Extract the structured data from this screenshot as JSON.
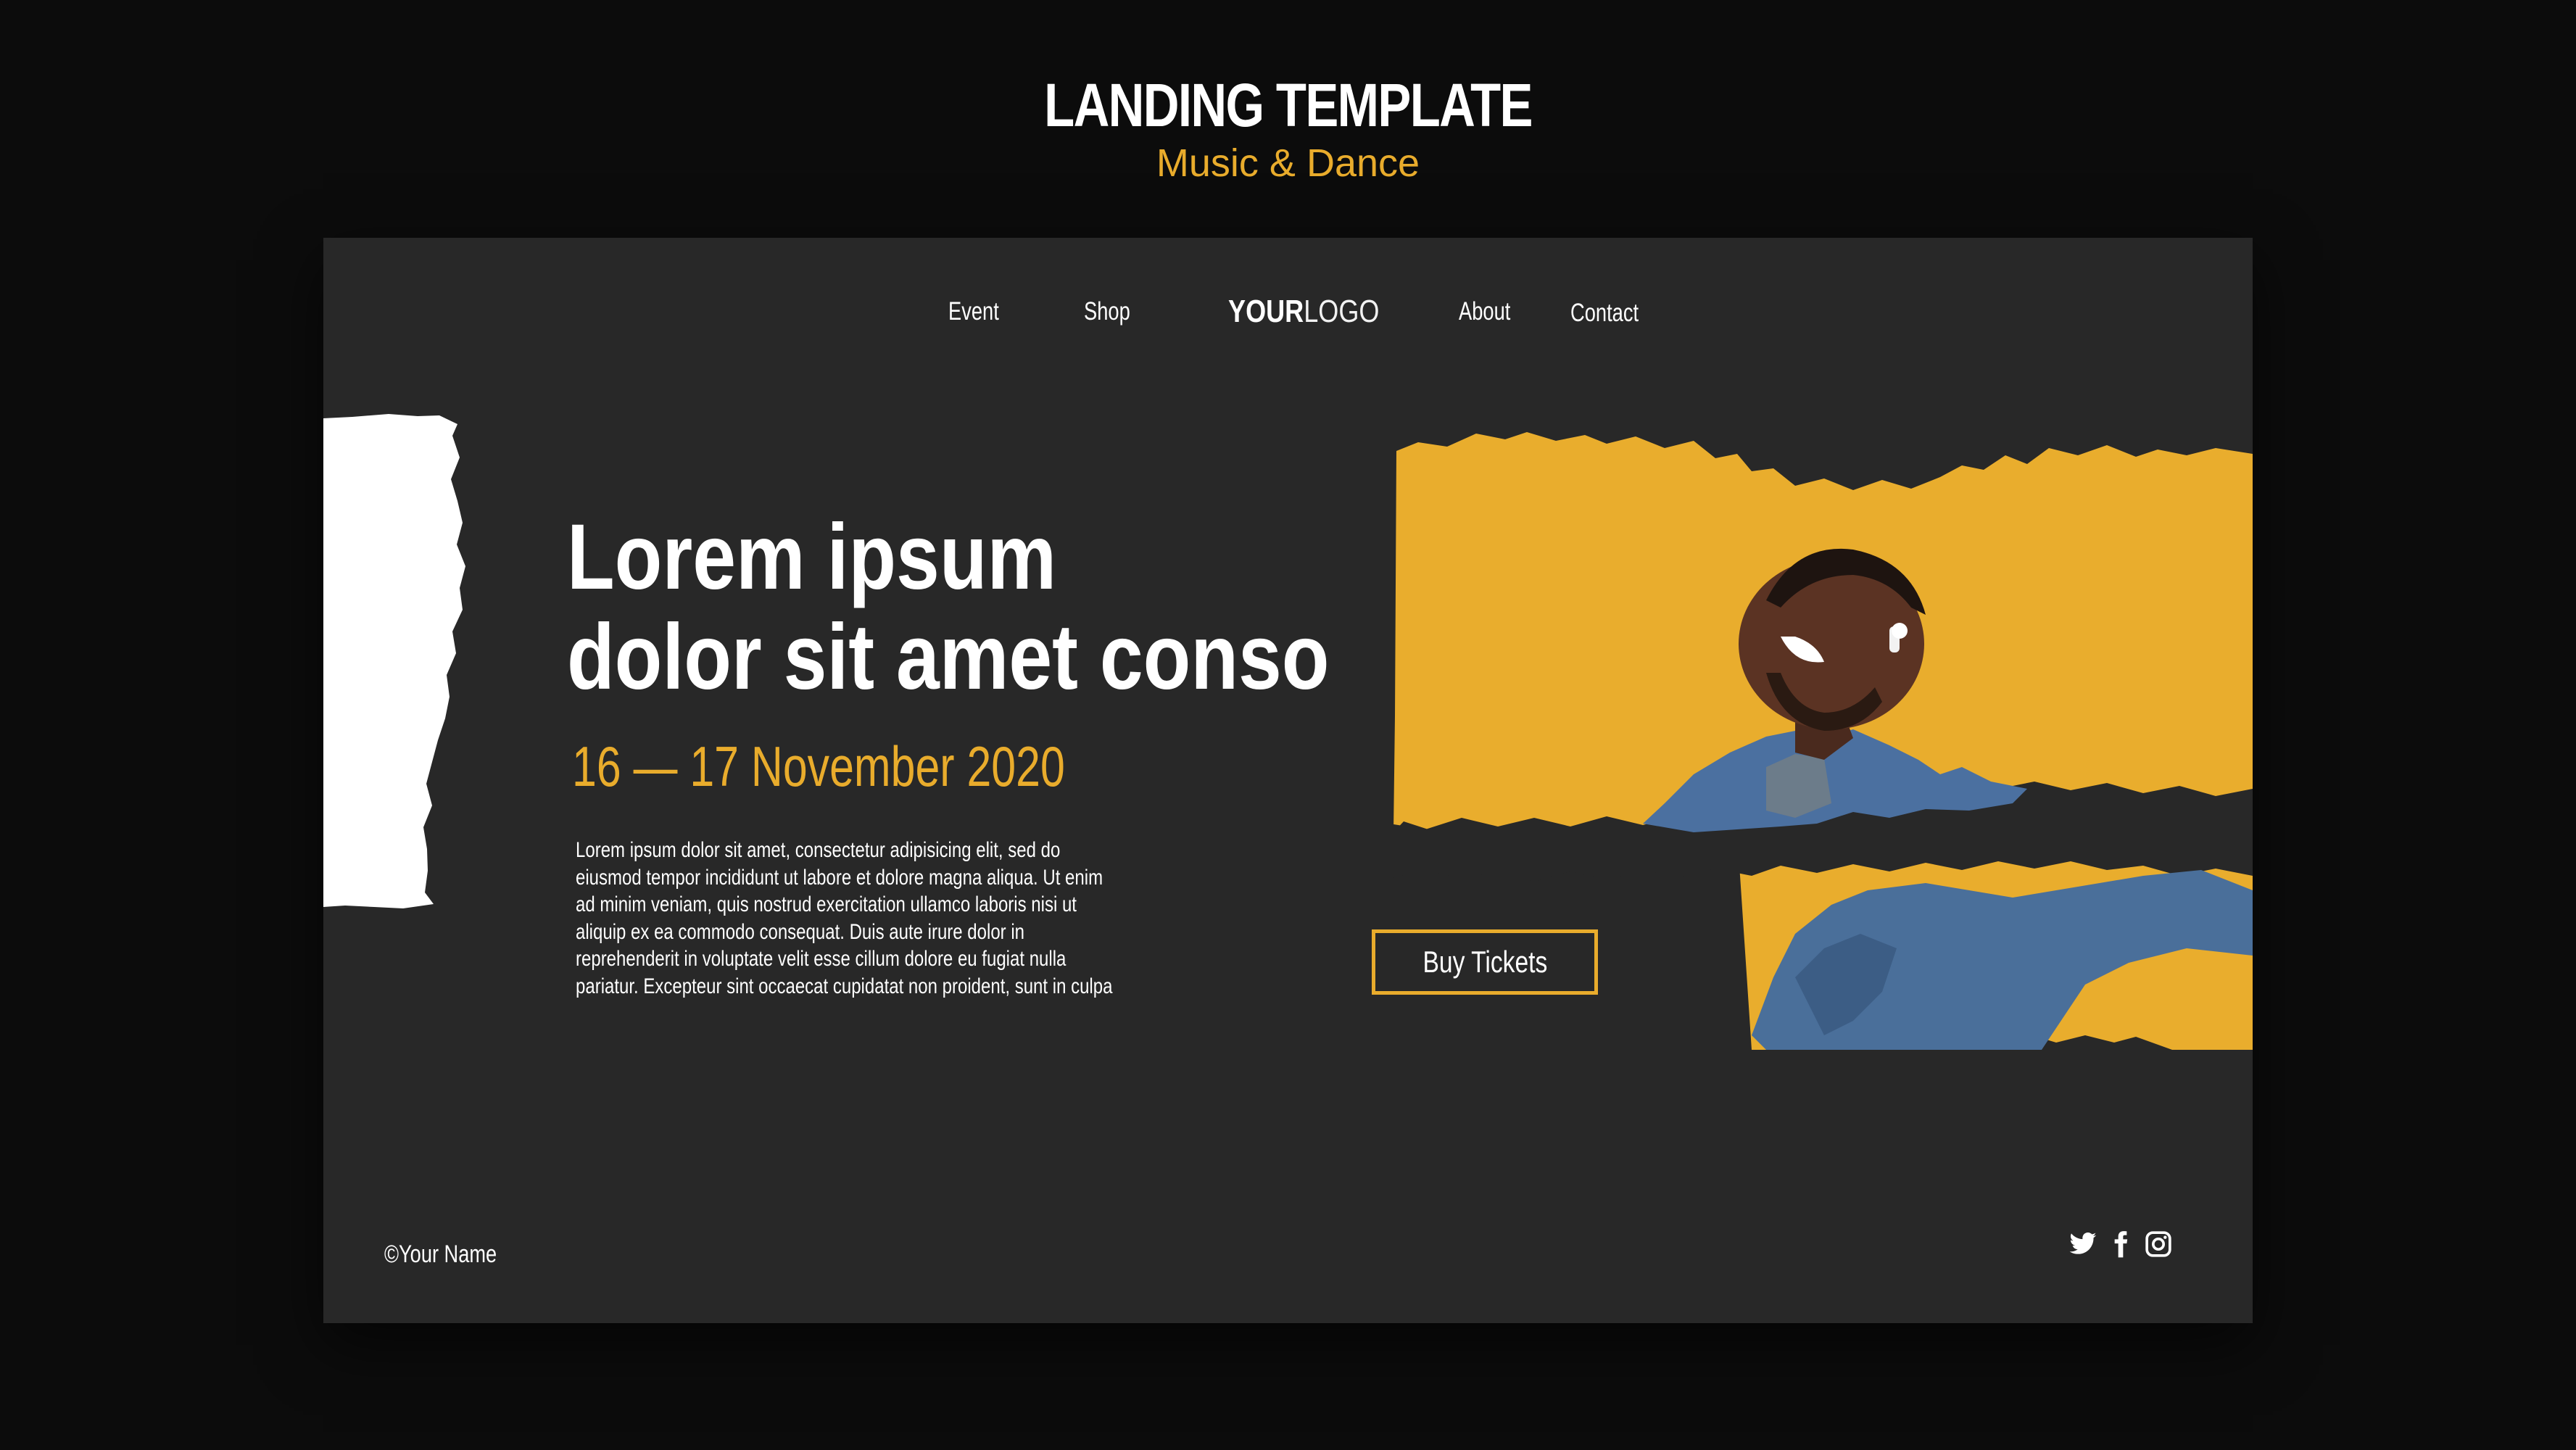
{
  "header": {
    "title": "LANDING TEMPLATE",
    "subtitle": "Music & Dance"
  },
  "nav": {
    "items": [
      {
        "label": "Event"
      },
      {
        "label": "Shop"
      },
      {
        "label": "About"
      },
      {
        "label": "Contact"
      }
    ],
    "logo_bold": "YOUR",
    "logo_thin": "LOGO"
  },
  "hero": {
    "title_line1": "Lorem ipsum",
    "title_line2": "dolor sit amet conso",
    "date": "16 — 17 November 2020",
    "body_lines": [
      "Lorem ipsum dolor sit amet, consectetur adipisicing elit, sed do",
      "eiusmod tempor incididunt ut labore et dolore magna aliqua. Ut enim",
      "ad minim veniam, quis nostrud exercitation ullamco laboris nisi ut",
      "aliquip ex ea commodo consequat. Duis aute irure dolor in",
      "reprehenderit in voluptate velit esse cillum dolore eu fugiat nulla",
      "pariatur. Excepteur sint occaecat cupidatat non proident, sunt in culpa"
    ],
    "cta_label": "Buy Tickets"
  },
  "footer": {
    "copyright": "©Your Name",
    "social_icons": [
      "twitter-icon",
      "facebook-icon",
      "instagram-icon"
    ]
  },
  "colors": {
    "page_bg": "#0c0c0c",
    "card_bg": "#282828",
    "accent": "#e9ac2c",
    "text": "#ffffff"
  }
}
